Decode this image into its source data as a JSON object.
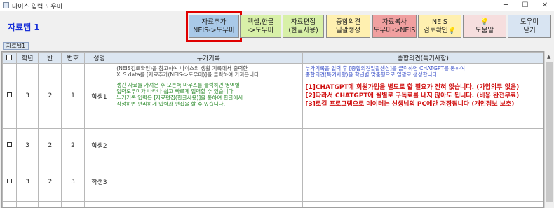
{
  "window": {
    "title": "나이스 입력 도우미",
    "min": "─",
    "max": "☐",
    "close": "✕"
  },
  "tab_title": "자료탭 1",
  "toolbar": [
    {
      "line1": "자료추가",
      "line2": "NEIS->도우미",
      "bg": "#a9c9e8"
    },
    {
      "line1": "엑셀,한글",
      "line2": "->도우미",
      "bg": "#d8f0a8"
    },
    {
      "line1": "자료편집",
      "line2": "(한글사용)",
      "bg": "#d8f0a8"
    },
    {
      "line1": "종합의견",
      "line2": "일괄생성",
      "bg": "#fff0b0"
    },
    {
      "line1": "자료복사",
      "line2": "도우미->NEIS",
      "bg": "#f0a0a0"
    },
    {
      "line1": "NEIS",
      "line2": "검토확인",
      "bg": "#fff0b0"
    },
    {
      "line1": "",
      "line2": "도움말",
      "bg": "#f6dede"
    },
    {
      "line1": "도우미",
      "line2": "닫기",
      "bg": "#d8e4f2"
    }
  ],
  "sheet_tab": "자료탭1",
  "grid": {
    "headers": {
      "check": "",
      "grade": "학년",
      "class": "반",
      "number": "번호",
      "name": "성명",
      "record": "누가기록",
      "opinion": "종합의견(특기사항)"
    },
    "rows": [
      {
        "grade": "3",
        "class": "2",
        "number": "1",
        "name": "학생1"
      },
      {
        "grade": "3",
        "class": "2",
        "number": "2",
        "name": "학생2"
      },
      {
        "grade": "3",
        "class": "2",
        "number": "3",
        "name": "학생3"
      }
    ],
    "record_gray": [
      "(NEIS검토확인)을 참고하여 나이스의 생활 기록에서 출력한",
      "XLS data를 [자료추가(NEIS->도우미)]를 클릭하여 가져옵니다."
    ],
    "record_green": [
      "생긴 자료를 가져온 후 오른쪽 마우스를 클릭하면 영역별",
      "입력도우미가 나타나 쉽고 빠르게 입력할 수 있습니다.",
      "누가기록 입력은 [자료편집(한글사용)]을 통하여 한글에서",
      "작성하면 편리하게 입력과 편집을 할 수 있습니다."
    ],
    "opinion_blue": [
      "누가기록을 입력 후 [종합의견일괄생성]을 클릭하면 CHATGPT를 통하여",
      "종합의견(특기사항)을 학년별 맞춤형으로 일괄로 생성합니다."
    ],
    "opinion_red": [
      "[1]CHATGPT에 회원가입을 별도로 할 필요가 전혀 없습니다. (가입의무 없음)",
      "[2]따라서 CHATGPT에 월별로 구독료를 내지 않아도 됩니다. (비용 완전무료)",
      "[3]로컬 프로그램으로 데이터는 선생님의 PC에만 저장됩니다 (개인정보 보호)"
    ]
  }
}
